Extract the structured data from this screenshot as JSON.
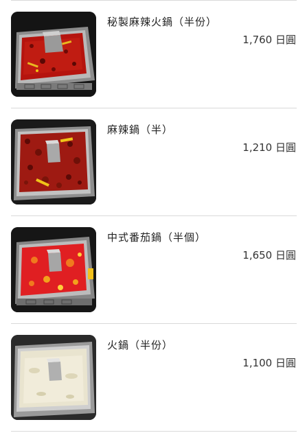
{
  "menu": {
    "items": [
      {
        "name": "秘製麻辣火鍋（半份）",
        "price": "1,760 日圓",
        "image": "spicy-hotpot-photo",
        "broth_color": "#b5140e"
      },
      {
        "name": "麻辣鍋（半）",
        "price": "1,210 日圓",
        "image": "mala-hotpot-photo",
        "broth_color": "#9e1a12"
      },
      {
        "name": "中式番茄鍋（半個）",
        "price": "1,650 日圓",
        "image": "tomato-hotpot-photo",
        "broth_color": "#e01f22"
      },
      {
        "name": "火鍋（半份）",
        "price": "1,100 日圓",
        "image": "clear-broth-hotpot-photo",
        "broth_color": "#e9e4cf"
      }
    ]
  }
}
